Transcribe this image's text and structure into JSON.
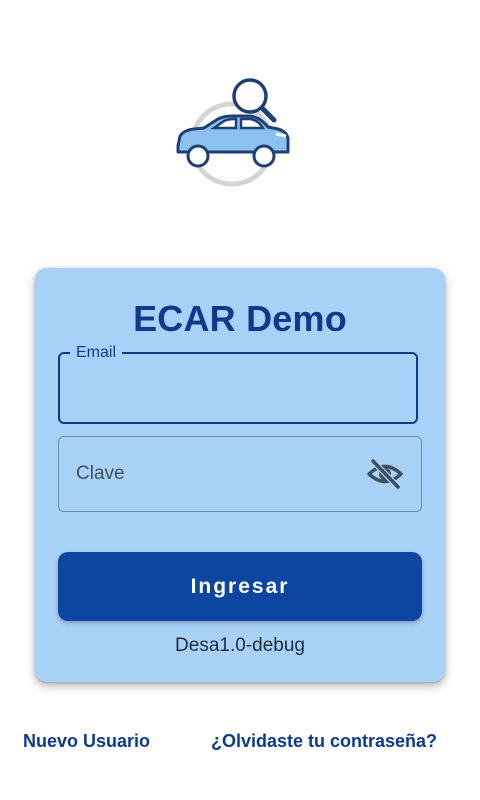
{
  "app": {
    "title": "ECAR Demo",
    "logo_icon": "car-search-icon",
    "version": "Desa1.0-debug"
  },
  "form": {
    "email_label": "Email",
    "email_value": "",
    "password_placeholder": "Clave",
    "password_value": "",
    "password_toggle_icon": "eye-off-icon",
    "submit_label": "Ingresar"
  },
  "links": {
    "new_user": "Nuevo Usuario",
    "forgot_password": "¿Olvidaste tu contraseña?"
  },
  "colors": {
    "primary": "#0d46a0",
    "title": "#0d3b8c",
    "card_background": "#a8d1f7"
  }
}
